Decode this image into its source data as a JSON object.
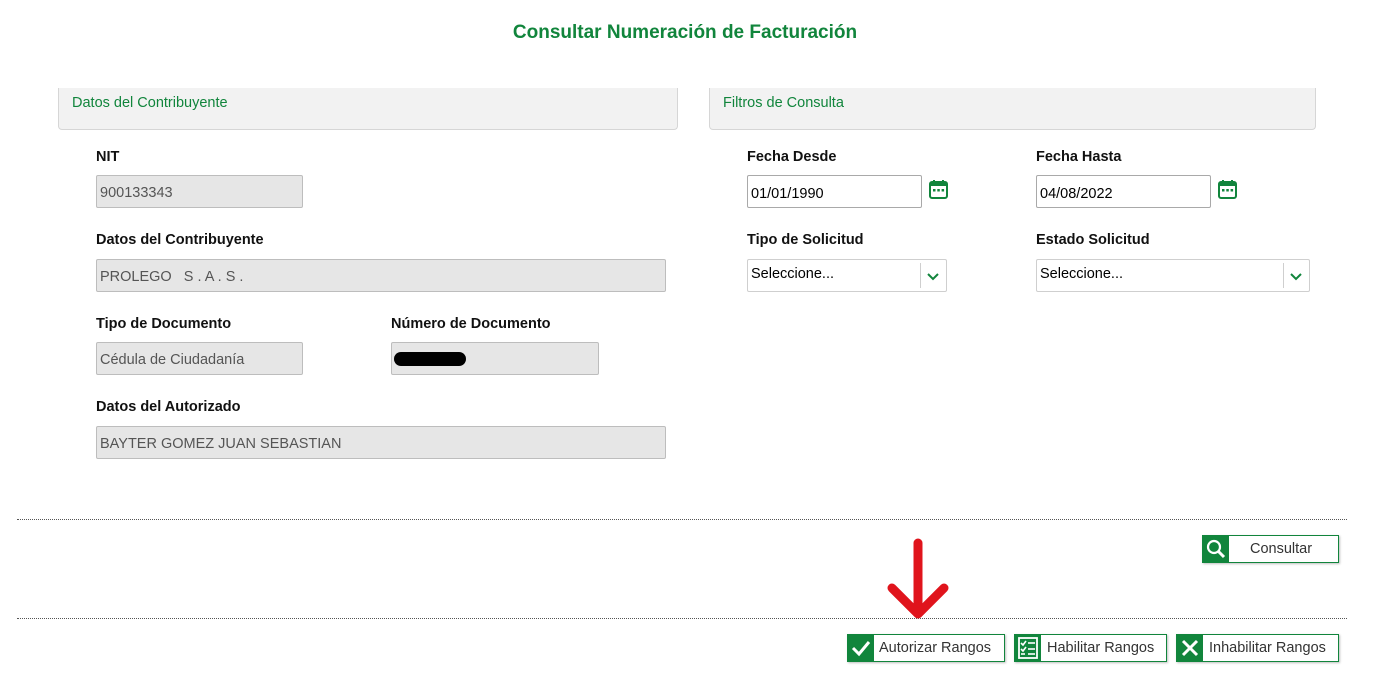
{
  "page": {
    "title": "Consultar Numeración de Facturación"
  },
  "contribuyente_panel": {
    "heading": "Datos del Contribuyente",
    "nit_label": "NIT",
    "nit_value": "900133343",
    "datos_label": "Datos del Contribuyente",
    "datos_value": "PROLEGO   S . A . S .",
    "tipo_doc_label": "Tipo de Documento",
    "tipo_doc_value": "Cédula de Ciudadanía",
    "num_doc_label": "Número de Documento",
    "num_doc_value": "",
    "autorizado_label": "Datos del Autorizado",
    "autorizado_value": "BAYTER GOMEZ JUAN SEBASTIAN"
  },
  "filtros_panel": {
    "heading": "Filtros de Consulta",
    "fecha_desde_label": "Fecha Desde",
    "fecha_desde_value": "01/01/1990",
    "fecha_hasta_label": "Fecha Hasta",
    "fecha_hasta_value": "04/08/2022",
    "tipo_solicitud_label": "Tipo de Solicitud",
    "tipo_solicitud_value": "Seleccione...",
    "estado_solicitud_label": "Estado Solicitud",
    "estado_solicitud_value": "Seleccione..."
  },
  "actions": {
    "consultar_label": "Consultar",
    "autorizar_label": "Autorizar Rangos",
    "habilitar_label": "Habilitar Rangos",
    "inhabilitar_label": "Inhabilitar Rangos"
  },
  "icons": {
    "calendar": "calendar-icon",
    "chevron": "chevron-down-icon",
    "search": "search-icon",
    "check": "check-icon",
    "checklist": "checklist-icon",
    "close": "close-icon",
    "arrow": "arrow-down-icon"
  },
  "colors": {
    "accent": "#11853c",
    "annotation_arrow": "#e0141c",
    "readonly_bg": "#e6e6e6",
    "panel_head_bg": "#f2f2f2"
  }
}
